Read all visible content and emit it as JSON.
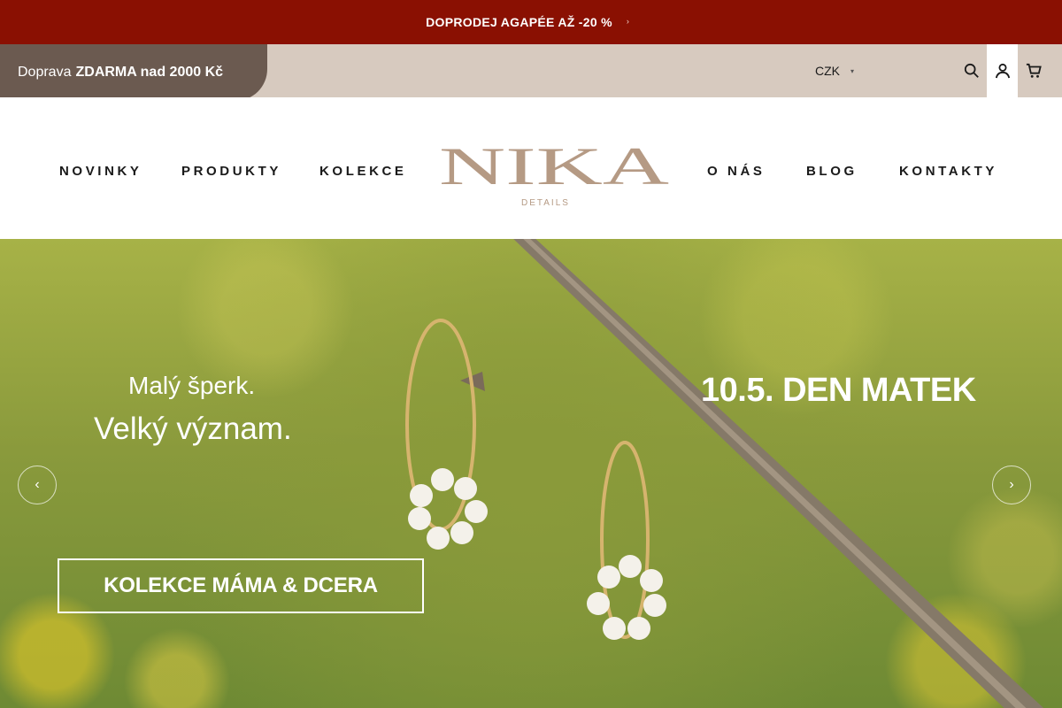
{
  "promo": {
    "text": "DOPRODEJ AGAPÉE AŽ -20 %",
    "arrow": "›"
  },
  "shipping": {
    "prefix": "Doprava",
    "highlight": "ZDARMA nad 2000 Kč"
  },
  "currency": {
    "selected": "CZK",
    "caret": "▾"
  },
  "util_icons": [
    "search-icon",
    "user-icon",
    "cart-icon"
  ],
  "nav": {
    "left": [
      "NOVINKY",
      "PRODUKTY",
      "KOLEKCE"
    ],
    "right": [
      "O NÁS",
      "BLOG",
      "KONTAKTY"
    ]
  },
  "logo": {
    "name": "NIKA",
    "tagline": "DETAILS"
  },
  "hero": {
    "tagline_line1": "Malý šperk.",
    "tagline_line2": "Velký význam.",
    "date": "10.5. DEN MATEK",
    "cta": "KOLEKCE MÁMA & DCERA",
    "prev": "‹",
    "next": "›"
  },
  "colors": {
    "promo_bg": "#8a1002",
    "util_bg": "#d7cabf",
    "shipping_bg": "#6b5a50",
    "logo_brand": "#b59a84"
  }
}
